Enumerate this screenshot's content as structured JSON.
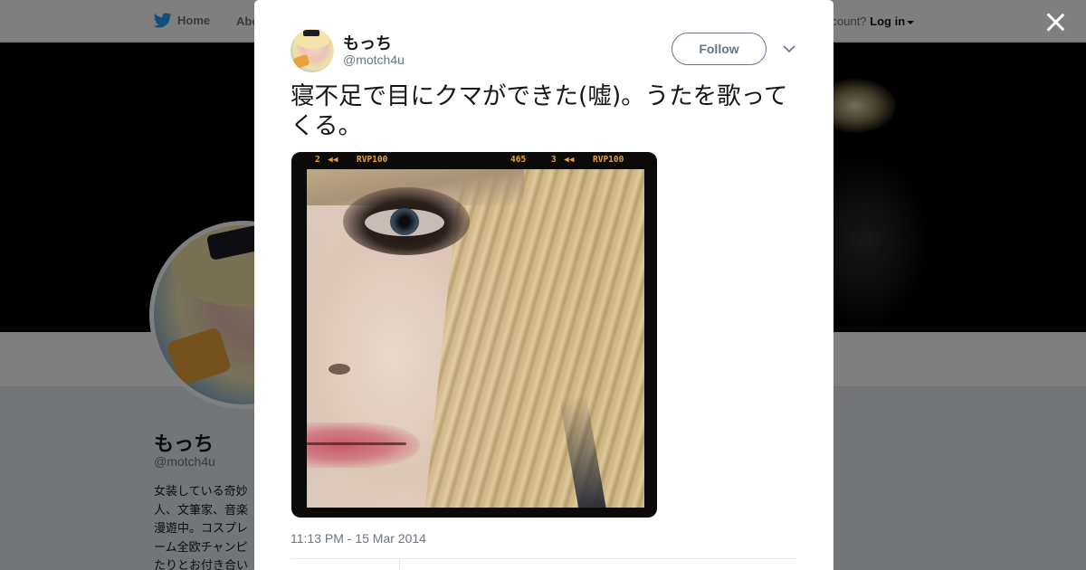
{
  "topnav": {
    "home_label": "Home",
    "about_label": "Abo",
    "account_prompt": "ccount?",
    "login_label": "Log in"
  },
  "profile": {
    "name": "もっち",
    "handle": "@motch4u",
    "bio": "女装している奇妙\n人、文筆家、音楽\n漫遊中。コスプレ\nーム全欧チャンピ\nたりとお付き合い"
  },
  "tweet": {
    "author_name": "もっち",
    "author_handle": "@motch4u",
    "follow_label": "Follow",
    "text": "寝不足で目にクマができた(嘘)。うたを歌ってくる。",
    "timestamp": "11:13 PM - 15 Mar 2014",
    "photo_film_labels": [
      "2",
      "RVP100",
      "465",
      "3",
      "RVP100"
    ]
  },
  "colors": {
    "twitter_blue": "#1da1f2",
    "secondary_text": "#657786",
    "primary_text": "#14171a",
    "film_orange": "#e6a334"
  },
  "icons": [
    "twitter-bird-icon",
    "caret-down-icon",
    "close-icon",
    "chevron-down-icon"
  ]
}
